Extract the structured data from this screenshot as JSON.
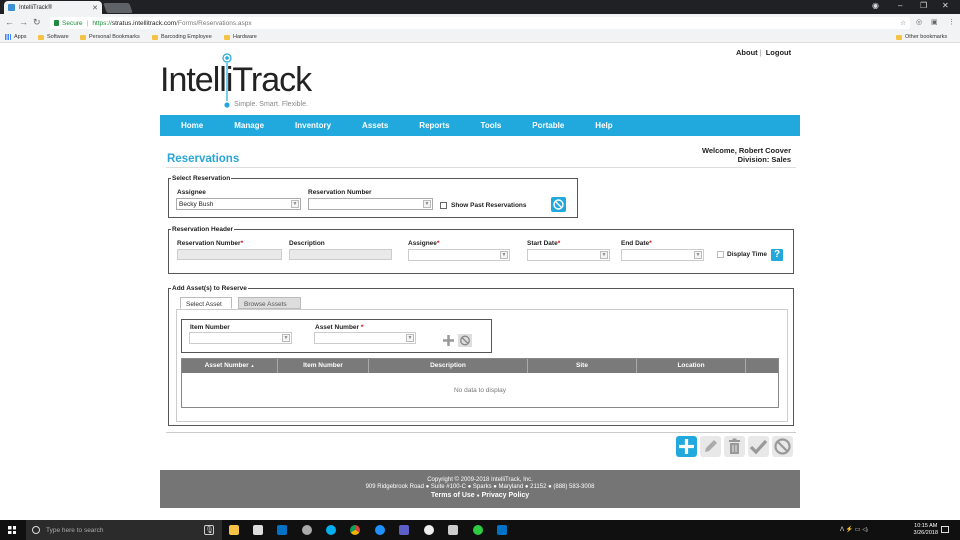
{
  "browser": {
    "tab_title": "IntelliTrack®",
    "secure_label": "Secure",
    "url_protocol": "https://",
    "url_host": "stratus.intellitrack.com",
    "url_path": "/Forms/Reservations.aspx",
    "bookmarks": [
      "Apps",
      "Software",
      "Personal Bookmarks",
      "Barcoding Employee",
      "Hardware"
    ],
    "other_bookmarks": "Other bookmarks"
  },
  "logo": {
    "brand": "IntelliTrack",
    "registered": ".",
    "tagline": "Simple. Smart. Flexible."
  },
  "top_links": {
    "about": "About",
    "separator": "|",
    "logout": "Logout"
  },
  "nav": [
    "Home",
    "Manage",
    "Inventory",
    "Assets",
    "Reports",
    "Tools",
    "Portable",
    "Help"
  ],
  "page": {
    "title": "Reservations",
    "welcome": "Welcome, Robert Coover",
    "division": "Division: Sales"
  },
  "select_reservation": {
    "legend": "Select Reservation",
    "assignee_label": "Assignee",
    "assignee_value": "Becky Bush",
    "resnum_label": "Reservation Number",
    "resnum_value": "",
    "show_past_label": "Show Past Reservations"
  },
  "reservation_header": {
    "legend": "Reservation Header",
    "resnum_label": "Reservation Number",
    "description_label": "Description",
    "assignee_label": "Assignee",
    "start_date_label": "Start Date",
    "end_date_label": "End Date",
    "display_time_label": "Display Time",
    "required_mark": "*"
  },
  "add_assets": {
    "legend": "Add Asset(s) to Reserve",
    "tabs": [
      "Select Asset",
      "Browse Assets"
    ],
    "item_number_label": "Item Number",
    "asset_number_label": "Asset Number",
    "required_mark": "*",
    "grid_columns": [
      "Asset Number",
      "Item Number",
      "Description",
      "Site",
      "Location"
    ],
    "no_data": "No data to display"
  },
  "footer": {
    "copyright": "Copyright © 2009-2018 IntelliTrack, Inc.",
    "address": "909 Ridgebrook Road ● Suite #100-C ● Sparks ● Maryland ● 21152 ● (888) 583-3008",
    "terms": "Terms of Use",
    "bullet": "●",
    "privacy": "Privacy Policy"
  },
  "taskbar": {
    "search_placeholder": "Type here to search",
    "time": "10:15 AM",
    "date": "3/26/2018"
  },
  "colors": {
    "brand_blue": "#21a9dd",
    "title_blue": "#2aa6d8",
    "footer_gray": "#757575"
  }
}
